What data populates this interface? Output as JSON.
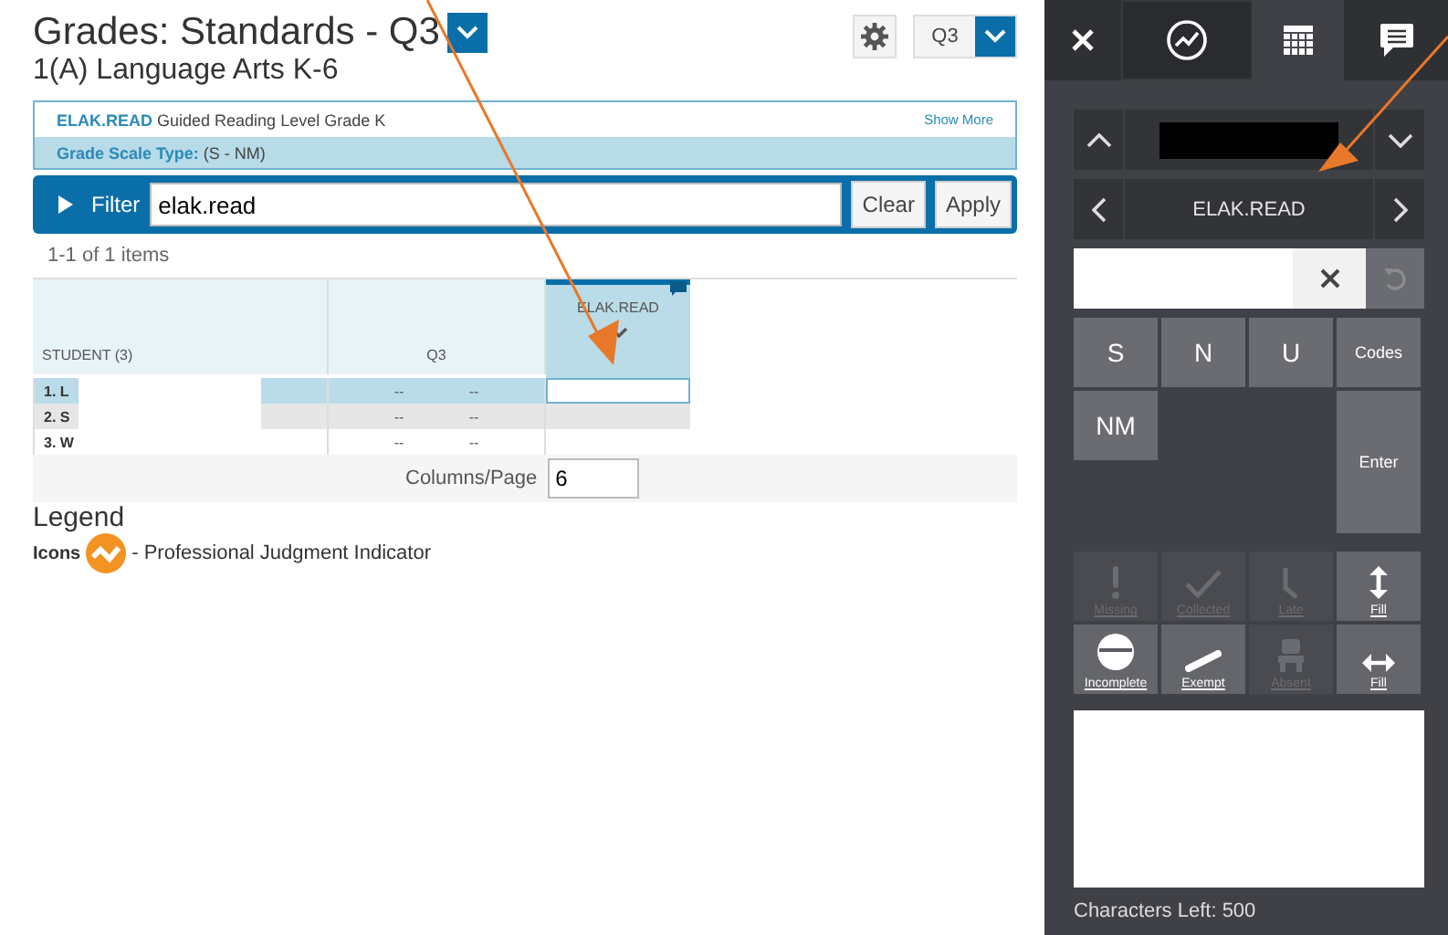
{
  "header": {
    "title": "Grades: Standards - Q3",
    "subtitle": "1(A) Language Arts K-6",
    "term": "Q3"
  },
  "standard": {
    "code": "ELAK.READ",
    "description": "Guided Reading Level Grade K",
    "show_more": "Show More",
    "scale_label": "Grade Scale Type:",
    "scale_value": "(S - NM)"
  },
  "filter": {
    "label": "Filter",
    "value": "elak.read",
    "buttons": [
      "Clear",
      "Apply"
    ]
  },
  "item_count": "1-1 of 1 items",
  "table": {
    "columns": [
      "STUDENT (3)",
      "Q3",
      "ELAK.READ"
    ],
    "rows": [
      {
        "student": "1.  L",
        "q3_a": "--",
        "q3_b": "--",
        "selected": true
      },
      {
        "student": "2.  S",
        "q3_a": "--",
        "q3_b": "--",
        "selected": false
      },
      {
        "student": "3.  W",
        "q3_a": "--",
        "q3_b": "--",
        "selected": false
      }
    ],
    "columns_per_page_label": "Columns/Page",
    "columns_per_page": "6"
  },
  "legend": {
    "title": "Legend",
    "icons_label": "Icons",
    "description": "- Professional Judgment Indicator"
  },
  "panel": {
    "tabs": [
      {
        "kind": "close",
        "selected": false
      },
      {
        "kind": "chart",
        "selected": false
      },
      {
        "kind": "grid",
        "selected": true
      },
      {
        "kind": "comment",
        "selected": false
      }
    ],
    "standard_nav": "ELAK.READ",
    "score_keys": [
      {
        "label": "S"
      },
      {
        "label": "N"
      },
      {
        "label": "U"
      },
      {
        "label": "Codes"
      },
      {
        "label": "NM"
      }
    ],
    "enter": "Enter",
    "flags": [
      {
        "kind": "missing",
        "label": "Missing",
        "disabled": true
      },
      {
        "kind": "collected",
        "label": "Collected",
        "disabled": true
      },
      {
        "kind": "late",
        "label": "Late",
        "disabled": true
      },
      {
        "kind": "fill-vertical",
        "label": "Fill",
        "disabled": false
      },
      {
        "kind": "incomplete",
        "label": "Incomplete",
        "disabled": false
      },
      {
        "kind": "exempt",
        "label": "Exempt",
        "disabled": false
      },
      {
        "kind": "absent",
        "label": "Absent",
        "disabled": true
      },
      {
        "kind": "fill-horizontal",
        "label": "Fill",
        "disabled": false
      }
    ],
    "characters_left": "Characters Left: 500"
  }
}
